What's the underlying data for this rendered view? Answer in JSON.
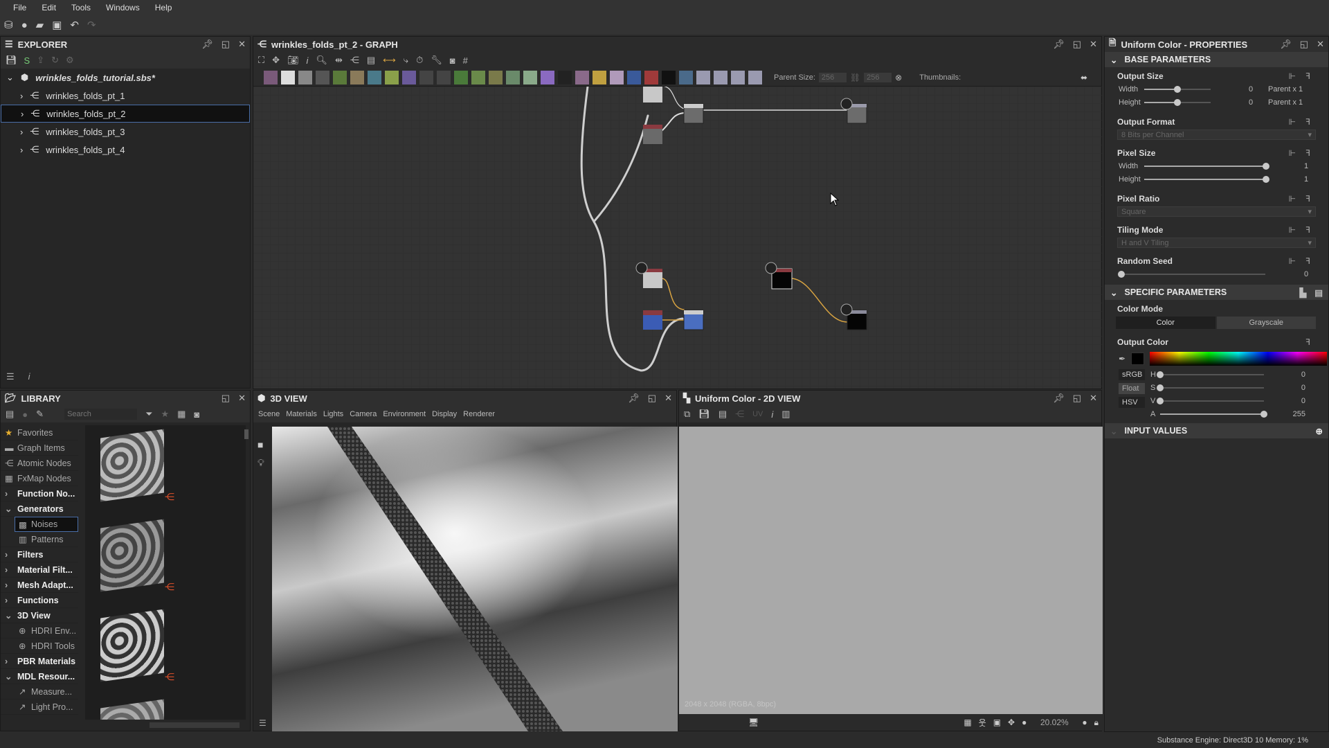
{
  "menu": [
    "File",
    "Edit",
    "Tools",
    "Windows",
    "Help"
  ],
  "explorer": {
    "title": "EXPLORER",
    "package": "wrinkles_folds_tutorial.sbs*",
    "graphs": [
      "wrinkles_folds_pt_1",
      "wrinkles_folds_pt_2",
      "wrinkles_folds_pt_3",
      "wrinkles_folds_pt_4"
    ],
    "selected_index": 1
  },
  "graph": {
    "title": "wrinkles_folds_pt_2 - GRAPH",
    "parent_size_label": "Parent Size:",
    "parent_size_w": "256",
    "parent_size_h": "256",
    "thumbnails_label": "Thumbnails:"
  },
  "library": {
    "title": "LIBRARY",
    "search_placeholder": "Search",
    "items": [
      {
        "label": "Favorites",
        "icon": "star-icon",
        "bold": false,
        "indent": 0
      },
      {
        "label": "Graph Items",
        "icon": "comment-icon",
        "bold": false,
        "indent": 0
      },
      {
        "label": "Atomic Nodes",
        "icon": "nodes-icon",
        "bold": false,
        "indent": 0
      },
      {
        "label": "FxMap Nodes",
        "icon": "grid-icon",
        "bold": false,
        "indent": 0
      },
      {
        "label": "Function No...",
        "icon": "chevron-right-icon",
        "bold": true,
        "indent": 0
      },
      {
        "label": "Generators",
        "icon": "chevron-down-icon",
        "bold": true,
        "indent": 0
      },
      {
        "label": "Noises",
        "icon": "noise-icon",
        "bold": false,
        "indent": 1,
        "selected": true
      },
      {
        "label": "Patterns",
        "icon": "pattern-icon",
        "bold": false,
        "indent": 1
      },
      {
        "label": "Filters",
        "icon": "chevron-right-icon",
        "bold": true,
        "indent": 0
      },
      {
        "label": "Material Filt...",
        "icon": "chevron-right-icon",
        "bold": true,
        "indent": 0
      },
      {
        "label": "Mesh Adapt...",
        "icon": "chevron-right-icon",
        "bold": true,
        "indent": 0
      },
      {
        "label": "Functions",
        "icon": "chevron-right-icon",
        "bold": true,
        "indent": 0
      },
      {
        "label": "3D View",
        "icon": "chevron-down-icon",
        "bold": true,
        "indent": 0
      },
      {
        "label": "HDRI Env...",
        "icon": "globe-icon",
        "bold": false,
        "indent": 1
      },
      {
        "label": "HDRI Tools",
        "icon": "globe-gear-icon",
        "bold": false,
        "indent": 1
      },
      {
        "label": "PBR Materials",
        "icon": "chevron-right-icon",
        "bold": true,
        "indent": 0
      },
      {
        "label": "MDL Resour...",
        "icon": "chevron-down-icon",
        "bold": true,
        "indent": 0
      },
      {
        "label": "Measure...",
        "icon": "link-icon",
        "bold": false,
        "indent": 1
      },
      {
        "label": "Light Pro...",
        "icon": "link-icon",
        "bold": false,
        "indent": 1
      }
    ]
  },
  "view3d": {
    "title": "3D VIEW",
    "menu": [
      "Scene",
      "Materials",
      "Lights",
      "Camera",
      "Environment",
      "Display",
      "Renderer"
    ]
  },
  "view2d": {
    "title": "Uniform Color - 2D VIEW",
    "uv_label": "UV",
    "image_info": "2048 x 2048 (RGBA, 8bpc)",
    "zoom": "20.02%"
  },
  "properties": {
    "title": "Uniform Color - PROPERTIES",
    "base_title": "BASE PARAMETERS",
    "output_size": {
      "label": "Output Size",
      "width_label": "Width",
      "height_label": "Height",
      "width_value": "0",
      "height_value": "0",
      "width_rel": "Parent x 1",
      "height_rel": "Parent x 1",
      "width_frac": 0.5,
      "height_frac": 0.5
    },
    "output_format": {
      "label": "Output Format",
      "value": "8 Bits per Channel"
    },
    "pixel_size": {
      "label": "Pixel Size",
      "width_label": "Width",
      "height_label": "Height",
      "width_value": "1",
      "height_value": "1",
      "width_frac": 1.0,
      "height_frac": 1.0
    },
    "pixel_ratio": {
      "label": "Pixel Ratio",
      "value": "Square"
    },
    "tiling_mode": {
      "label": "Tiling Mode",
      "value": "H and V Tiling"
    },
    "random_seed": {
      "label": "Random Seed",
      "value": "0",
      "frac": 0
    },
    "specific_title": "SPECIFIC PARAMETERS",
    "color_mode": {
      "label": "Color Mode",
      "options": [
        "Color",
        "Grayscale"
      ],
      "selected": "Color"
    },
    "output_color": {
      "label": "Output Color",
      "swatch": "#000000",
      "modes": [
        "sRGB",
        "Float",
        "HSV"
      ],
      "channels": [
        {
          "label": "H",
          "value": "0",
          "frac": 0
        },
        {
          "label": "S",
          "value": "0",
          "frac": 0
        },
        {
          "label": "V",
          "value": "0",
          "frac": 0
        },
        {
          "label": "A",
          "value": "255",
          "frac": 1
        }
      ]
    },
    "input_title": "INPUT VALUES"
  },
  "status": {
    "engine": "Substance Engine: Direct3D 10  Memory: 1%"
  },
  "colors": {
    "selection": "#4a6ea8",
    "wire_orange": "#d9a441",
    "node_header": "#8a3a40"
  }
}
